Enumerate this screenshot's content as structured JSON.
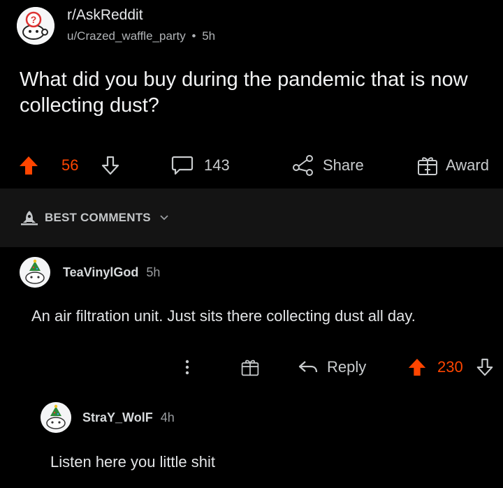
{
  "post": {
    "subreddit": "r/AskReddit",
    "author": "u/Crazed_waffle_party",
    "separator": "•",
    "age": "5h",
    "title": "What did you buy during the pandemic that is now collecting dust?",
    "upvotes": "56",
    "comments": "143",
    "share_label": "Share",
    "award_label": "Award"
  },
  "sort": {
    "label": "BEST COMMENTS"
  },
  "comments": [
    {
      "username": "TeaVinylGod",
      "age": "5h",
      "body": "An air filtration unit. Just sits there collecting dust all day.",
      "reply_label": "Reply",
      "score": "230"
    },
    {
      "username": "StraY_WolF",
      "age": "4h",
      "body": "Listen here you little shit"
    }
  ],
  "colors": {
    "upvote": "#ff4500",
    "background": "#000000",
    "band": "#141414"
  }
}
